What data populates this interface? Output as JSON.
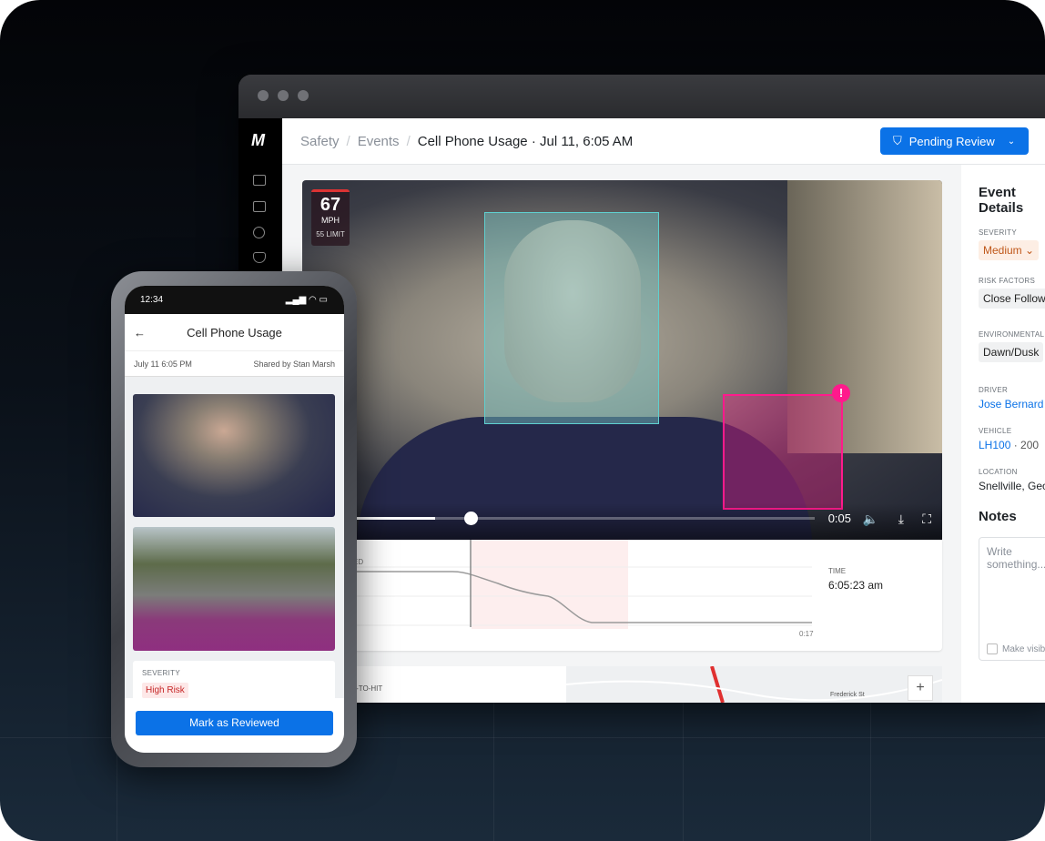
{
  "browser": {
    "sidebar_logo": "M"
  },
  "header": {
    "breadcrumb": [
      "Safety",
      "Events"
    ],
    "title": "Cell Phone Usage",
    "timestamp": "· Jul 11, 6:05 AM",
    "status_button": "Pending Review"
  },
  "video": {
    "speed": "67",
    "speed_unit": "MPH",
    "speed_limit": "55 LIMIT",
    "current_time": "0:05",
    "progress": 0.26
  },
  "speed_chart": {
    "label": "SPEED",
    "end_label": "0:17",
    "time_label": "TIME",
    "time_value": "6:05:23 am"
  },
  "map_panel": {
    "label": "TIME-TO-HIT",
    "street": "Frederick St"
  },
  "event_details": {
    "title": "Event Details",
    "severity_label": "SEVERITY",
    "severity": "Medium",
    "risk_label": "RISK FACTORS",
    "risk": "Close Following",
    "env_label": "ENVIRONMENTAL",
    "env": "Dawn/Dusk",
    "driver_label": "DRIVER",
    "driver": "Jose Bernard",
    "vehicle_label": "VEHICLE",
    "vehicle": "LH100",
    "vehicle_extra": "· 200",
    "location_label": "LOCATION",
    "location": "Snellville, Georgia"
  },
  "notes": {
    "title": "Notes",
    "placeholder": "Write something...",
    "visibility": "Make visible"
  },
  "phone": {
    "clock": "12:34",
    "title": "Cell Phone Usage",
    "date": "July 11  6:05 PM",
    "shared_by": "Shared by Stan Marsh",
    "severity_label": "SEVERITY",
    "severity": "High Risk",
    "action": "Mark as Reviewed"
  },
  "colors": {
    "accent": "#0b72e7",
    "alert": "#ff1a8c"
  }
}
